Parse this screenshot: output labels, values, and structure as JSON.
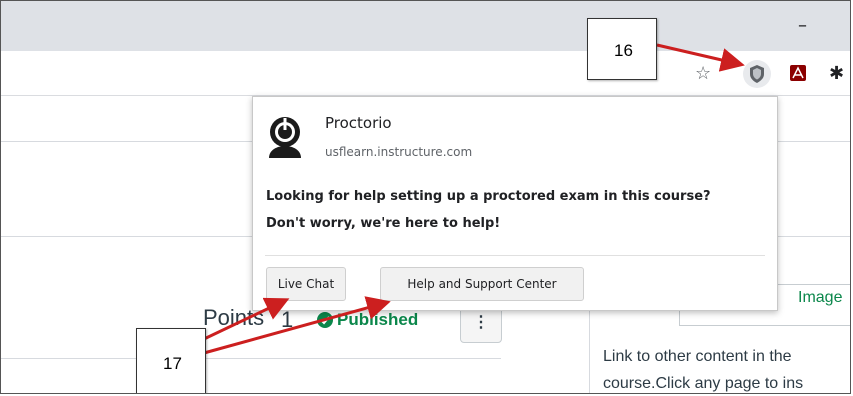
{
  "browser": {
    "minimize_glyph": "–",
    "star_glyph": "☆",
    "puzzle_glyph": "✱"
  },
  "page": {
    "points_label": "Points",
    "points_value": "1",
    "published_label": "Published",
    "kebab_glyph": "⋮",
    "image_tab": "Image",
    "link_text": "Link to other content in the",
    "course_text": "course.Click any page to ins"
  },
  "popup": {
    "title": "Proctorio",
    "domain": "usflearn.instructure.com",
    "message_line1": "Looking for help setting up a proctored exam in this course?",
    "message_line2": "Don't worry, we're here to help!",
    "live_chat_label": "Live Chat",
    "help_center_label": "Help and Support Center"
  },
  "callouts": {
    "c16": "16",
    "c17": "17"
  },
  "colors": {
    "annotation_arrow": "#cc1f1f",
    "published_green": "#0b874b",
    "titlebar": "#dee1e6"
  }
}
